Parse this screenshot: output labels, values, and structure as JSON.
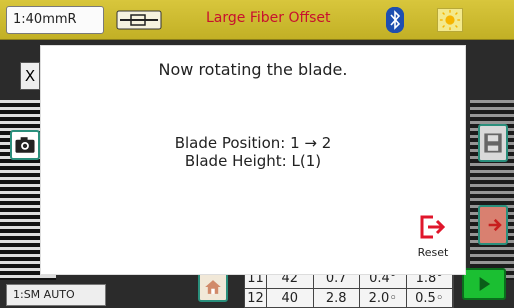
{
  "status_bar": {
    "pressure": "1:40mmR",
    "title": "Large Fiber Offset",
    "title_color": "#c8102e",
    "icons": [
      "fiber-holder-icon",
      "bluetooth-icon",
      "brightness-icon"
    ]
  },
  "background": {
    "close_label": "X",
    "mode_label": "1:SM AUTO",
    "table_rows": [
      [
        "11",
        "42",
        "0.7",
        "0.4°",
        "1.8°"
      ],
      [
        "12",
        "40",
        "2.8",
        "2.0◦",
        "0.5◦"
      ]
    ],
    "icons": [
      "camera-icon",
      "save-icon",
      "home-icon",
      "next-icon",
      "start-icon"
    ]
  },
  "dialog": {
    "title": "Now rotating the blade.",
    "blade_position": "Blade Position: 1 → 2",
    "blade_height": "Blade Height: L(1)",
    "reset_label": "Reset",
    "accent_color": "#e0162b"
  }
}
